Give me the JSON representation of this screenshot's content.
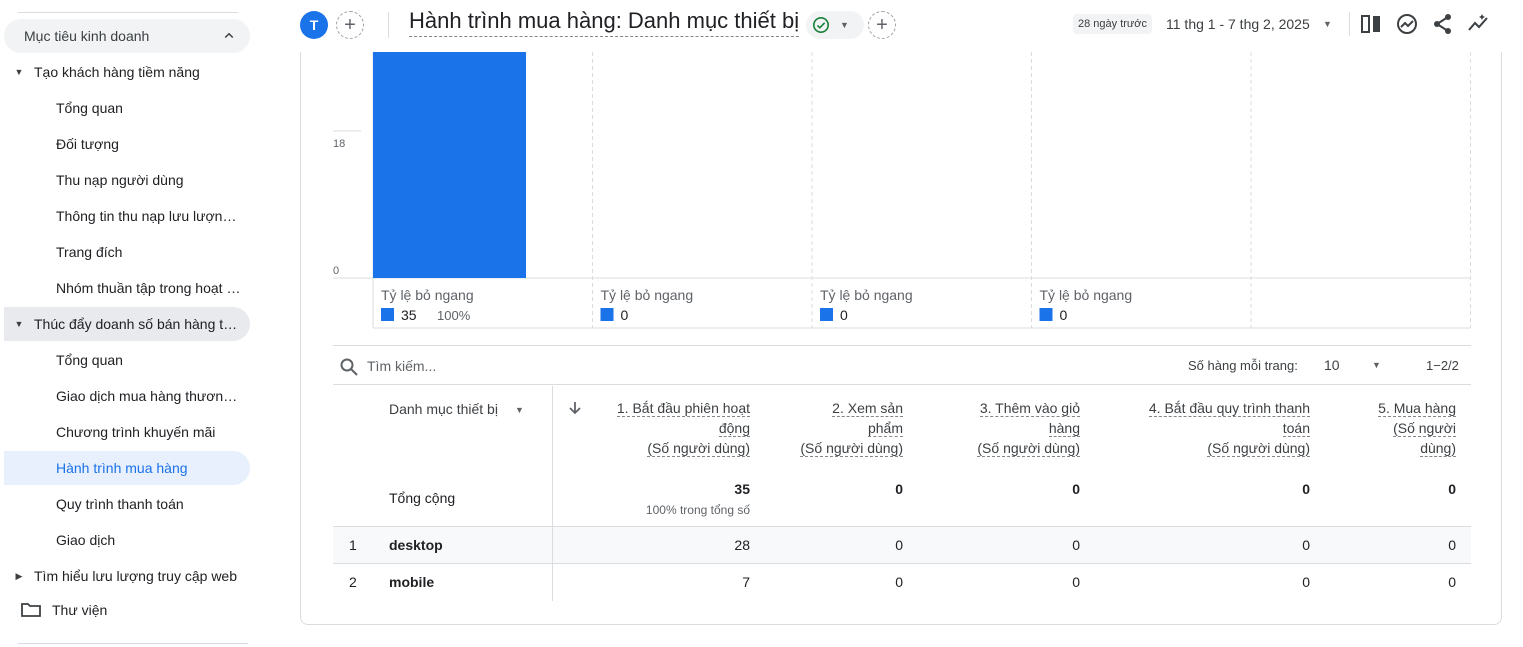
{
  "sidebar": {
    "section_title": "Mục tiêu kinh doanh",
    "groups": [
      {
        "label": "Tạo khách hàng tiềm năng",
        "items": [
          "Tổng quan",
          "Đối tượng",
          "Thu nạp người dùng",
          "Thông tin thu nạp lưu lượng truy cập",
          "Trang đích",
          "Nhóm thuần tập trong hoạt động"
        ]
      },
      {
        "label": "Thúc đẩy doanh số bán hàng trực tuyến",
        "items": [
          "Tổng quan",
          "Giao dịch mua hàng thương mại điện tử",
          "Chương trình khuyến mãi",
          "Hành trình mua hàng",
          "Quy trình thanh toán",
          "Giao dịch"
        ]
      },
      {
        "label": "Tìm hiểu lưu lượng truy cập web",
        "items": []
      }
    ],
    "library_label": "Thư viện",
    "active_item": "Hành trình mua hàng"
  },
  "header": {
    "avatar_letter": "T",
    "title": "Hành trình mua hàng: Danh mục thiết bị",
    "date_chip": "28 ngày trước",
    "date_range": "11 thg 1 - 7 thg 2, 2025",
    "icons": [
      "compare-icon",
      "insights-icon",
      "share-icon",
      "trend-icon"
    ],
    "status_color": "#188038"
  },
  "chart_data": {
    "type": "bar",
    "categories": [
      "1. Bắt đầu phiên hoạt động",
      "2. Xem sản phẩm",
      "3. Thêm vào giỏ hàng",
      "4. Bắt đầu quy trình thanh toán",
      "5. Mua hàng"
    ],
    "values": [
      35,
      0,
      0,
      0,
      0
    ],
    "y_ticks": [
      0,
      18
    ],
    "ylim": [
      0,
      35
    ],
    "drop_label": "Tỷ lệ bỏ ngang",
    "step_values": [
      "35",
      "0",
      "0",
      "0"
    ],
    "first_percent": "100%",
    "bar_color": "#1a73e8",
    "grid": true
  },
  "table": {
    "search_placeholder": "Tìm kiếm...",
    "rows_per_page_label": "Số hàng mỗi trang:",
    "rows_per_page": "10",
    "pagination": "1−2/2",
    "dimension_header": "Danh mục thiết bị",
    "metric_headers": [
      [
        "1. Bắt đầu phiên hoạt",
        "động",
        "(Số người dùng)"
      ],
      [
        "2. Xem sản",
        "phẩm",
        "(Số người dùng)"
      ],
      [
        "3. Thêm vào giỏ",
        "hàng",
        "(Số người dùng)"
      ],
      [
        "4. Bắt đầu quy trình thanh",
        "toán",
        "(Số người dùng)"
      ],
      [
        "5. Mua hàng",
        "(Số người",
        "dùng)"
      ]
    ],
    "total_label": "Tổng cộng",
    "totals": [
      "35",
      "0",
      "0",
      "0",
      "0"
    ],
    "total_sub": "100% trong tổng số",
    "rows": [
      {
        "index": "1",
        "dimension": "desktop",
        "values": [
          "28",
          "0",
          "0",
          "0",
          "0"
        ]
      },
      {
        "index": "2",
        "dimension": "mobile",
        "values": [
          "7",
          "0",
          "0",
          "0",
          "0"
        ]
      }
    ]
  }
}
